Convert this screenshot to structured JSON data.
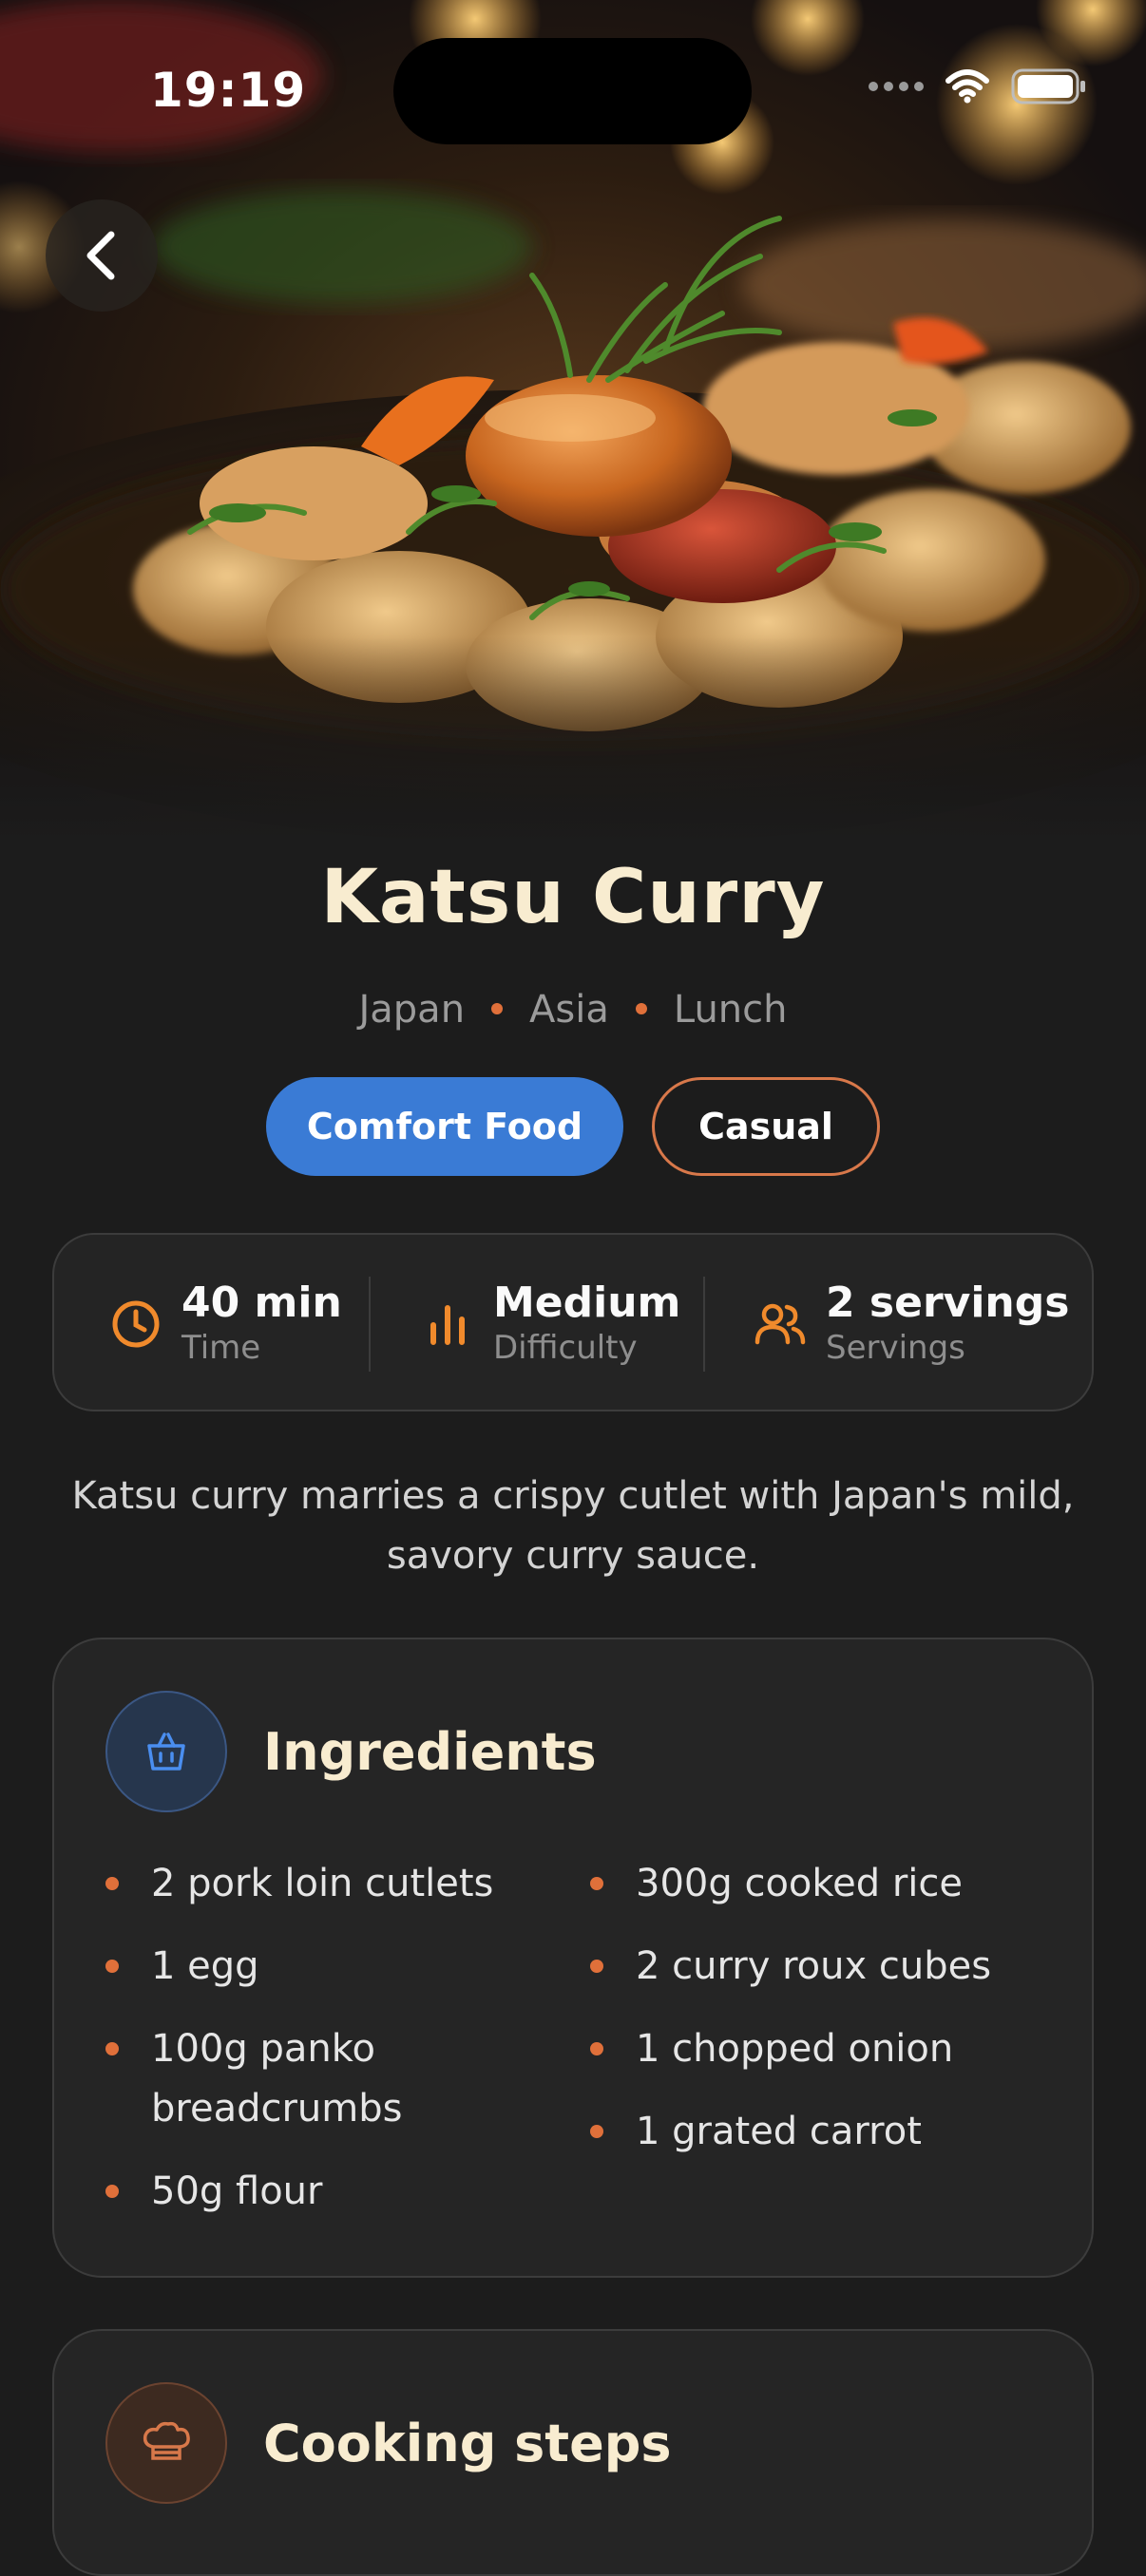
{
  "status_bar": {
    "time": "19:19"
  },
  "recipe": {
    "title": "Katsu Curry",
    "meta": [
      "Japan",
      "Asia",
      "Lunch"
    ],
    "tags": [
      "Comfort Food",
      "Casual"
    ],
    "stats": [
      {
        "icon": "clock-icon",
        "value": "40 min",
        "label": "Time"
      },
      {
        "icon": "bar-chart-icon",
        "value": "Medium",
        "label": "Difficulty"
      },
      {
        "icon": "users-icon",
        "value": "2 servings",
        "label": "Servings"
      }
    ],
    "description": "Katsu curry marries a crispy cutlet with Japan's mild, savory curry sauce."
  },
  "ingredients": {
    "title": "Ingredients",
    "icon": "basket-icon",
    "left": [
      "2 pork loin cutlets",
      "1 egg",
      "100g panko breadcrumbs",
      "50g flour"
    ],
    "right": [
      "300g cooked rice",
      "2 curry roux cubes",
      "1 chopped onion",
      "1 grated carrot"
    ]
  },
  "steps": {
    "title": "Cooking steps",
    "icon": "chef-hat-icon"
  },
  "colors": {
    "accent_orange": "#e0703a",
    "accent_blue": "#3a7bd5",
    "background": "#1c1c1c",
    "title_cream": "#f8ecd0"
  }
}
